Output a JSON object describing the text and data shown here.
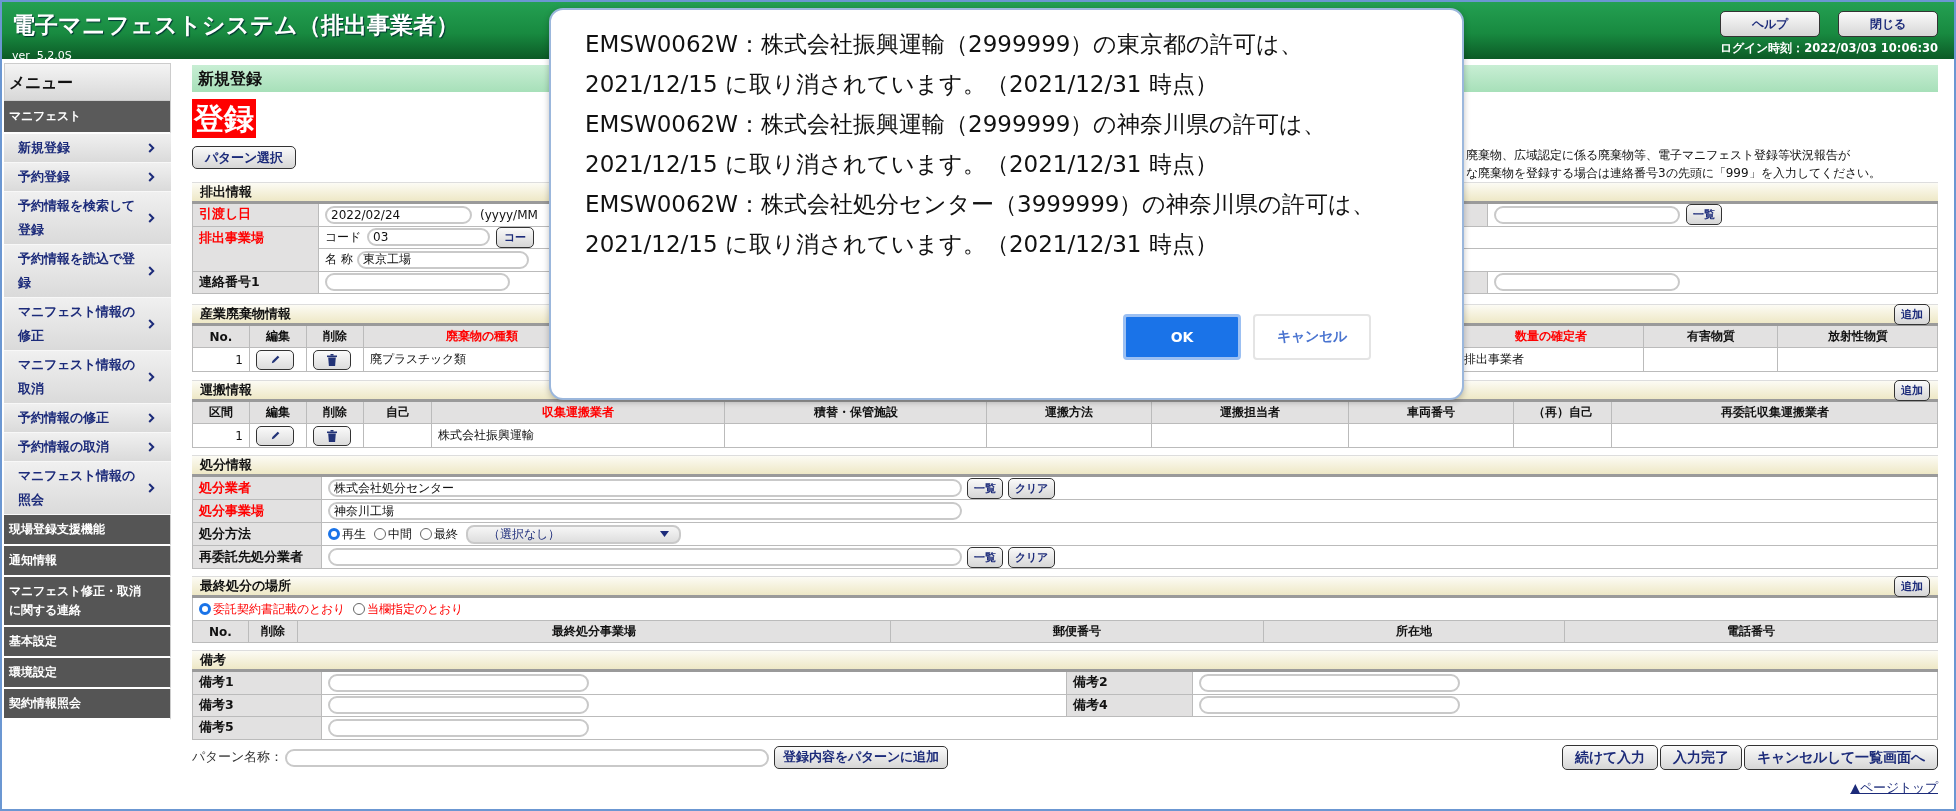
{
  "header": {
    "title": "電子マニフェストシステム（排出事業者）",
    "version": "ver  5.2.0S",
    "buttons": [
      "ヘルプ",
      "閉じる"
    ],
    "login_time": "ログイン時刻：2022/03/03 10:06:30"
  },
  "sidebar": {
    "title": "メニュー",
    "groups": [
      {
        "label": "マニフェスト",
        "items": [
          "新規登録",
          "予約登録",
          "予約情報を検索して登録",
          "予約情報を読込で登録",
          "マニフェスト情報の修正",
          "マニフェスト情報の取消",
          "予約情報の修正",
          "予約情報の取消",
          "マニフェスト情報の照会"
        ]
      },
      {
        "label": "現場登録支援機能"
      },
      {
        "label": "通知情報"
      },
      {
        "label": "マニフェスト修正・取消に関する連絡"
      },
      {
        "label": "基本設定"
      },
      {
        "label": "環境設定"
      },
      {
        "label": "契約情報照会"
      }
    ]
  },
  "page": {
    "title": "新規登録",
    "badge": "登録",
    "pattern_button": "パターン選択",
    "notice_lines": [
      "廃棄物、広域認定に係る廃棄物等、電子マニフェスト登録等状況報告が",
      "な廃棄物を登録する場合は連絡番号3の先頭に「999」を入力してください。"
    ]
  },
  "discharge": {
    "title": "排出情報",
    "date": {
      "label": "引渡し日",
      "required": true,
      "value": "2022/02/24",
      "hint": "(yyyy/MM"
    },
    "site": {
      "label": "排出事業場",
      "required": true,
      "code_label": "コード",
      "code": "03",
      "code_button": "コー",
      "name_label": "名 称",
      "name": "東京工場"
    },
    "contact": {
      "label": "連絡番号1",
      "required": false
    },
    "list_button": "一覧"
  },
  "waste": {
    "title": "産業廃棄物情報",
    "add_button": "追加",
    "columns": [
      {
        "label": "No.",
        "required": false
      },
      {
        "label": "編集",
        "required": false
      },
      {
        "label": "削除",
        "required": false
      },
      {
        "label": "廃棄物の種類",
        "required": true
      },
      {
        "label": "数量の確定者",
        "required": true
      },
      {
        "label": "有害物質",
        "required": false
      },
      {
        "label": "放射性物質",
        "required": false
      }
    ],
    "rows": [
      {
        "no": "1",
        "waste_type": "廃プラスチック類",
        "confirmer": "排出事業者"
      }
    ]
  },
  "transport": {
    "title": "運搬情報",
    "add_button": "追加",
    "columns": [
      {
        "label": "区間",
        "required": false
      },
      {
        "label": "編集",
        "required": false
      },
      {
        "label": "削除",
        "required": false
      },
      {
        "label": "自己",
        "required": false
      },
      {
        "label": "収集運搬業者",
        "required": true
      },
      {
        "label": "積替・保管施設",
        "required": false
      },
      {
        "label": "運搬方法",
        "required": false
      },
      {
        "label": "運搬担当者",
        "required": false
      },
      {
        "label": "車両番号",
        "required": false
      },
      {
        "label": "（再）自己",
        "required": false
      },
      {
        "label": "再委託収集運搬業者",
        "required": false
      }
    ],
    "rows": [
      {
        "no": "1",
        "carrier": "株式会社振興運輸"
      }
    ]
  },
  "disposal": {
    "title": "処分情報",
    "rows": [
      {
        "kind": "lookup",
        "label": "処分業者",
        "required": true,
        "value": "株式会社処分センター",
        "buttons": [
          "一覧",
          "クリア"
        ]
      },
      {
        "kind": "text",
        "label": "処分事業場",
        "required": true,
        "value": "神奈川工場"
      },
      {
        "kind": "method",
        "label": "処分方法",
        "required": false,
        "options": [
          {
            "label": "再生",
            "selected": true
          },
          {
            "label": "中間",
            "selected": false
          },
          {
            "label": "最終",
            "selected": false
          }
        ],
        "select": "（選択なし）"
      },
      {
        "kind": "lookup",
        "label": "再委託先処分業者",
        "required": false,
        "buttons": [
          "一覧",
          "クリア"
        ]
      }
    ]
  },
  "final_disposal": {
    "title": "最終処分の場所",
    "add_button": "追加",
    "options": [
      {
        "label": "委託契約書記載のとおり",
        "selected": true
      },
      {
        "label": "当欄指定のとおり",
        "selected": false
      }
    ],
    "columns": [
      "No.",
      "削除",
      "最終処分事業場",
      "郵便番号",
      "所在地",
      "電話番号"
    ]
  },
  "remarks": {
    "title": "備考",
    "fields": [
      {
        "label": "備考1"
      },
      {
        "label": "備考2"
      },
      {
        "label": "備考3"
      },
      {
        "label": "備考4"
      },
      {
        "label": "備考5"
      }
    ]
  },
  "footer": {
    "pattern_label": "パターン名称：",
    "pattern_add_button": "登録内容をパターンに追加",
    "buttons": [
      "続けて入力",
      "入力完了",
      "キャンセルして一覧画面へ"
    ],
    "page_top_link": "▲ページトップ"
  },
  "dialog": {
    "messages": [
      "EMSW0062W：株式会社振興運輸（2999999）の東京都の許可は、2021/12/15 に取り消されています。（2021/12/31 時点）",
      "EMSW0062W：株式会社振興運輸（2999999）の神奈川県の許可は、2021/12/15 に取り消されています。（2021/12/31 時点）",
      "EMSW0062W：株式会社処分センター（3999999）の神奈川県の許可は、2021/12/15 に取り消されています。（2021/12/31 時点）"
    ],
    "buttons": [
      {
        "label": "OK",
        "primary": true
      },
      {
        "label": "キャンセル",
        "primary": false
      }
    ]
  }
}
